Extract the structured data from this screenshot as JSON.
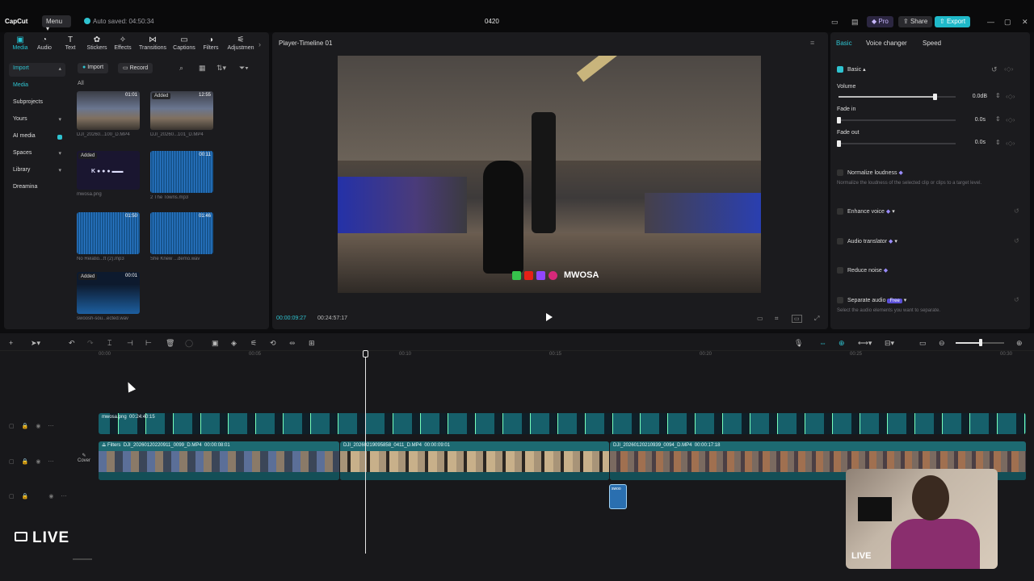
{
  "topbar": {
    "app_name": "CapCut",
    "menu_label": "Menu",
    "autosave": "Auto saved: 04:50:34",
    "project_title": "0420",
    "pro_label": "Pro",
    "share_label": "Share",
    "export_label": "Export"
  },
  "tools": [
    {
      "label": "Media",
      "icon": "▣"
    },
    {
      "label": "Audio",
      "icon": "◔"
    },
    {
      "label": "Text",
      "icon": "T"
    },
    {
      "label": "Stickers",
      "icon": "✿"
    },
    {
      "label": "Effects",
      "icon": "✧"
    },
    {
      "label": "Transitions",
      "icon": "⋈"
    },
    {
      "label": "Captions",
      "icon": "▭"
    },
    {
      "label": "Filters",
      "icon": "◑"
    },
    {
      "label": "Adjustmen",
      "icon": "⚟"
    }
  ],
  "side_nav": {
    "import": "Import",
    "media": "Media",
    "subprojects": "Subprojects",
    "yours": "Yours",
    "ai_media": "AI media",
    "spaces": "Spaces",
    "library": "Library",
    "dreamina": "Dreamina"
  },
  "media": {
    "import_btn": "Import",
    "record_btn": "Record",
    "filter_all": "All",
    "items": [
      {
        "name": "DJI_20260...100_D.MP4",
        "duration": "01:01",
        "added": ""
      },
      {
        "name": "DJI_20260...101_D.MP4",
        "duration": "12:55",
        "added": "Added"
      },
      {
        "name": "mwosa.png",
        "duration": "",
        "added": "Added"
      },
      {
        "name": "2 The Towns.mp3",
        "duration": "00:11",
        "added": ""
      },
      {
        "name": "No Relatio...ft (2).mp3",
        "duration": "01:50",
        "added": ""
      },
      {
        "name": "She Knew ...demo.wav",
        "duration": "01:46",
        "added": ""
      },
      {
        "name": "swoosh-sou...ected.wav",
        "duration": "00:01",
        "added": "Added"
      }
    ]
  },
  "player": {
    "title": "Player-Timeline 01",
    "time_current": "00:00:09:27",
    "time_total": "00:24:57:17",
    "watermark": "MWOSA"
  },
  "props": {
    "tabs": [
      "Basic",
      "Voice changer",
      "Speed"
    ],
    "section_basic": "Basic",
    "volume_label": "Volume",
    "volume_value": "0.0dB",
    "volume_level": 0.82,
    "fade_in_label": "Fade in",
    "fade_in_value": "0.0s",
    "fade_out_label": "Fade out",
    "fade_out_value": "0.0s",
    "normalize_label": "Normalize loudness",
    "normalize_desc": "Normalize the loudness of the selected clip or clips to a target level.",
    "enhance_label": "Enhance voice",
    "translator_label": "Audio translator",
    "reduce_label": "Reduce noise",
    "separate_label": "Separate audio",
    "separate_badge": "Free",
    "separate_desc": "Select the audio elements you want to separate."
  },
  "timeline": {
    "ruler": [
      "00:00",
      "00:05",
      "00:10",
      "00:15",
      "00:20",
      "00:25",
      "00:30"
    ],
    "overlay_clip": {
      "name": "mwosa.png",
      "duration": "00:24:40:15"
    },
    "clip1": {
      "prefix": "Filters",
      "name": "DJI_20260120220911_0099_D.MP4",
      "duration": "00:00:08:01"
    },
    "clip2": {
      "name": "DJI_20260219095858_0411_D.MP4",
      "duration": "00:00:09:01"
    },
    "clip3": {
      "name": "DJI_20260120210939_0094_D.MP4",
      "duration": "00:00:17:18"
    },
    "cover_label": "Cover",
    "small_clip_label": "swoo"
  },
  "overlay": {
    "live_label": "LIVE",
    "cam_live_label": "LIVE"
  },
  "colors": {
    "accent": "#2fc3d0",
    "export": "#1fb9c9",
    "clip": "#1d6a72"
  }
}
